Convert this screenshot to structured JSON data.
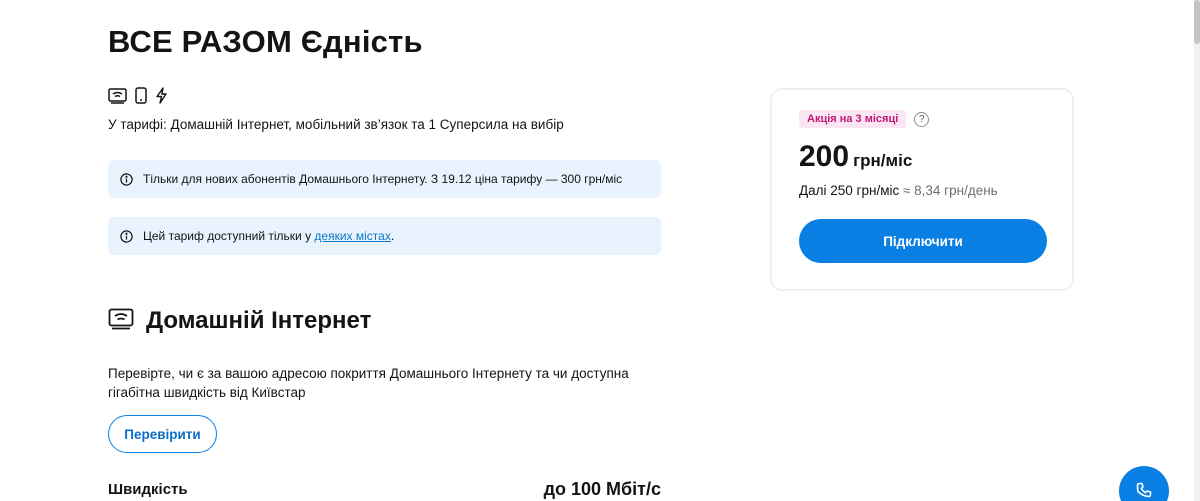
{
  "tariff": {
    "title": "ВСЕ РАЗОМ Єдність",
    "feature_icons": [
      "home-internet-icon",
      "mobile-phone-icon",
      "lightning-icon"
    ],
    "description": "У тарифі: Домашній Інтернет, мобільний зв’язок та 1 Суперсила на вибір"
  },
  "notices": {
    "new_subscribers": "Тільки для нових абонентів Домашнього Інтернету. З 19.12 ціна тарифу — 300 грн/міс",
    "availability_prefix": "Цей тариф доступний тільки у ",
    "availability_link": "деяких містах",
    "availability_suffix": "."
  },
  "home_internet": {
    "heading": "Домашній Інтернет",
    "description": "Перевірте, чи є за вашою адресою покриття Домашнього Інтернету та чи доступна гігабітна швидкість від Київстар",
    "check_button": "Перевірити",
    "speed_label": "Швидкість",
    "speed_value": "до 100 Мбіт/с"
  },
  "price_card": {
    "promo_badge": "Акція на 3 місяці",
    "help_label": "?",
    "amount": "200",
    "unit": "грн/міс",
    "later_price": "Далі 250 грн/міс",
    "per_day": "≈ 8,34 грн/день",
    "connect_button": "Підключити"
  },
  "colors": {
    "accent": "#0a7fe3",
    "notice_bg": "#e9f3fd",
    "promo_bg": "#fbe7f3",
    "promo_text": "#c2187a"
  }
}
